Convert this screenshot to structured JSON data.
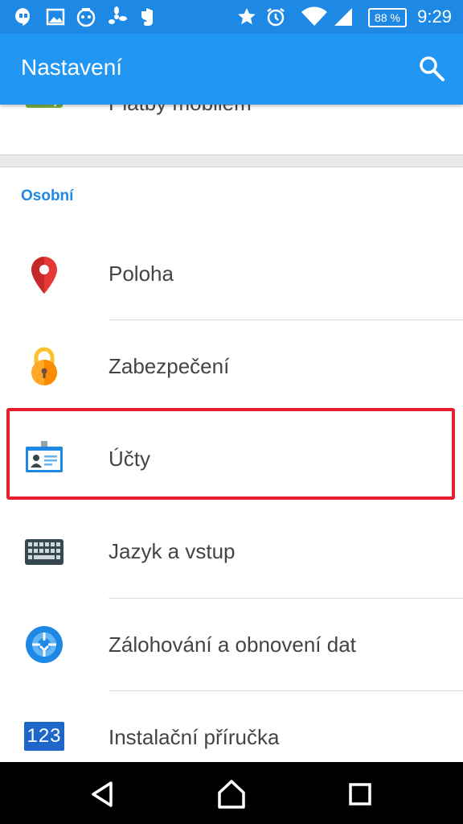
{
  "status_bar": {
    "time": "9:29",
    "battery": "88 %",
    "left_icons": [
      "hangouts-icon",
      "gallery-icon",
      "robot-icon",
      "fan-icon",
      "evernote-icon"
    ],
    "right_icons": [
      "star-icon",
      "alarm-icon",
      "wifi-icon",
      "signal-icon"
    ]
  },
  "app_bar": {
    "title": "Nastavení",
    "search_icon": "search-icon",
    "color": "#2196f3"
  },
  "partial_item": {
    "label": "Platby mobilem",
    "icon": "nfc-payment-icon"
  },
  "section": {
    "header": "Osobní",
    "accent": "#1e88e5"
  },
  "items": [
    {
      "label": "Poloha",
      "icon": "location-pin-icon"
    },
    {
      "label": "Zabezpečení",
      "icon": "lock-icon"
    },
    {
      "label": "Účty",
      "icon": "account-card-icon"
    },
    {
      "label": "Jazyk a vstup",
      "icon": "keyboard-icon"
    },
    {
      "label": "Zálohování a obnovení dat",
      "icon": "backup-icon"
    },
    {
      "label": "Instalační příručka",
      "icon": "setup-guide-icon",
      "icon_text": "123"
    }
  ],
  "highlight_color": "#e8202e",
  "nav_bar": {
    "buttons": [
      "back-icon",
      "home-icon",
      "recents-icon"
    ]
  }
}
